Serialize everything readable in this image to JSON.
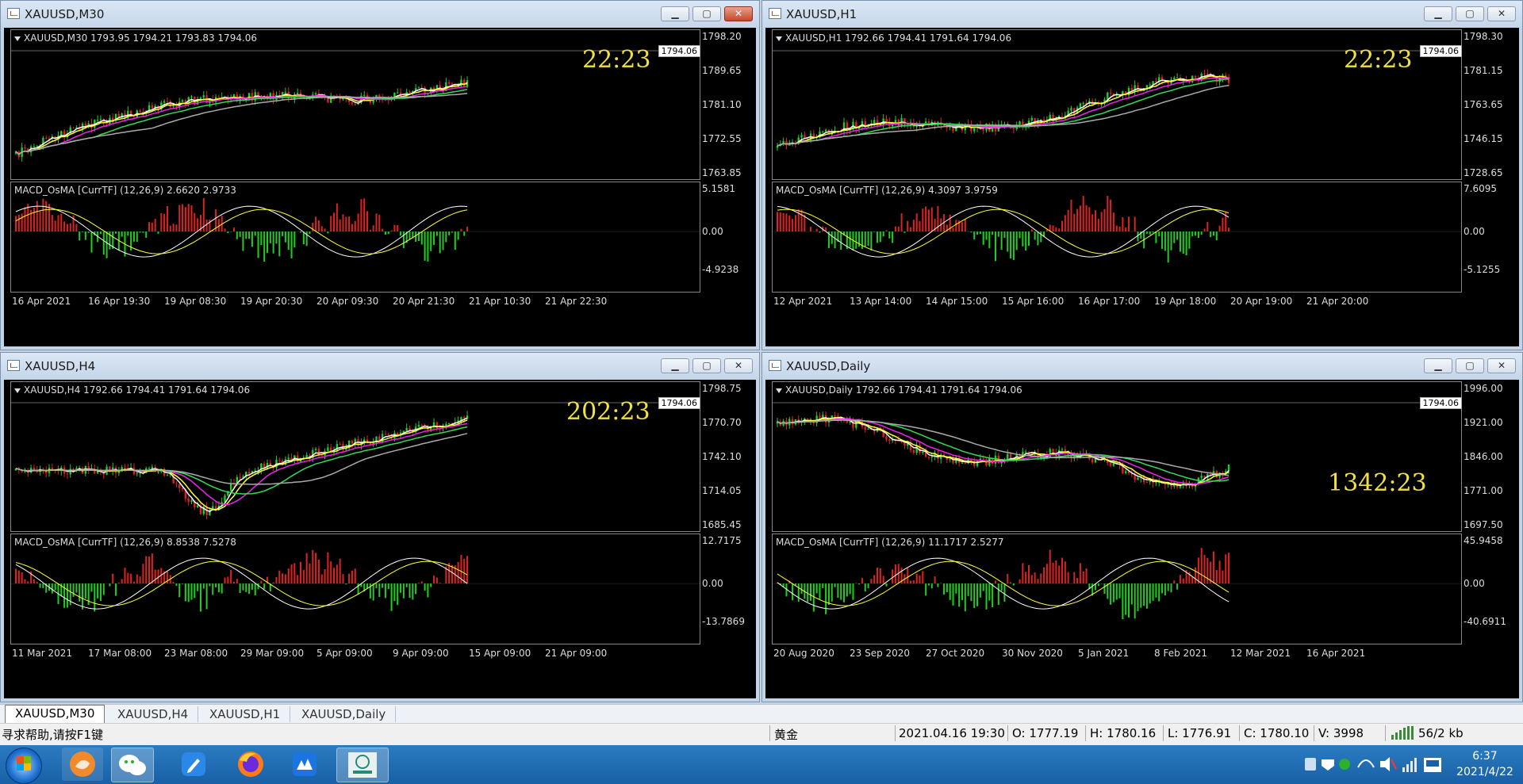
{
  "windows": [
    {
      "id": "m30",
      "title": "XAUUSD,M30",
      "active": true,
      "header": "XAUUSD,M30  1793.95 1794.21 1793.83 1794.06",
      "price_axis": [
        "1798.20",
        "1789.65",
        "1781.10",
        "1772.55",
        "1763.85"
      ],
      "price_tag": "1794.06",
      "countdown": "22:23",
      "macd_header": "MACD_OsMA [CurrTF] (12,26,9) 2.6620 2.9733",
      "macd_axis": [
        "5.1581",
        "0.00",
        "-4.9238"
      ],
      "times": [
        "16 Apr 2021",
        "16 Apr 19:30",
        "19 Apr 08:30",
        "19 Apr 20:30",
        "20 Apr 09:30",
        "20 Apr 21:30",
        "21 Apr 10:30",
        "21 Apr 22:30"
      ]
    },
    {
      "id": "h1",
      "title": "XAUUSD,H1",
      "active": false,
      "header": "XAUUSD,H1  1792.66 1794.41 1791.64 1794.06",
      "price_axis": [
        "1798.30",
        "1781.15",
        "1763.65",
        "1746.15",
        "1728.65"
      ],
      "price_tag": "1794.06",
      "countdown": "22:23",
      "macd_header": "MACD_OsMA [CurrTF] (12,26,9) 4.3097 3.9759",
      "macd_axis": [
        "7.6095",
        "0.00",
        "-5.1255"
      ],
      "times": [
        "12 Apr 2021",
        "13 Apr 14:00",
        "14 Apr 15:00",
        "15 Apr 16:00",
        "16 Apr 17:00",
        "19 Apr 18:00",
        "20 Apr 19:00",
        "21 Apr 20:00"
      ]
    },
    {
      "id": "h4",
      "title": "XAUUSD,H4",
      "active": false,
      "header": "XAUUSD,H4  1792.66 1794.41 1791.64 1794.06",
      "price_axis": [
        "1798.75",
        "1770.70",
        "1742.10",
        "1714.05",
        "1685.45"
      ],
      "price_tag": "1794.06",
      "countdown": "202:23",
      "macd_header": "MACD_OsMA [CurrTF] (12,26,9) 8.8538 7.5278",
      "macd_axis": [
        "12.7175",
        "0.00",
        "-13.7869"
      ],
      "times": [
        "11 Mar 2021",
        "17 Mar 08:00",
        "23 Mar 08:00",
        "29 Mar 09:00",
        "5 Apr 09:00",
        "9 Apr 09:00",
        "15 Apr 09:00",
        "21 Apr 09:00"
      ]
    },
    {
      "id": "d1",
      "title": "XAUUSD,Daily",
      "active": false,
      "header": "XAUUSD,Daily  1792.66 1794.41 1791.64 1794.06",
      "price_axis": [
        "1996.00",
        "1921.00",
        "1846.00",
        "1771.00",
        "1697.50"
      ],
      "price_tag": "1794.06",
      "countdown": "1342:23",
      "macd_header": "MACD_OsMA [CurrTF] (12,26,9) 11.1717 2.5277",
      "macd_axis": [
        "45.9458",
        "0.00",
        "-40.6911"
      ],
      "times": [
        "20 Aug 2020",
        "23 Sep 2020",
        "27 Oct 2020",
        "30 Nov 2020",
        "5 Jan 2021",
        "8 Feb 2021",
        "12 Mar 2021",
        "16 Apr 2021"
      ]
    }
  ],
  "tabs": [
    "XAUUSD,M30",
    "XAUUSD,H4",
    "XAUUSD,H1",
    "XAUUSD,Daily"
  ],
  "status": {
    "help": "寻求帮助,请按F1键",
    "symbol": "黄金",
    "datetime": "2021.04.16 19:30",
    "open": "O: 1777.19",
    "high": "H: 1780.16",
    "low": "L: 1776.91",
    "close": "C: 1780.10",
    "volume": "V: 3998",
    "traffic": "56/2 kb"
  },
  "clock": {
    "time": "6:37",
    "date": "2021/4/22"
  },
  "colors": {
    "bull": "#22cc22",
    "bear": "#dd2222",
    "ma_white": "#ffffff",
    "ma_yellow": "#ffff33",
    "ma_magenta": "#ee22ee",
    "ma_green": "#33dd55",
    "ma_gray": "#aaaaaa",
    "countdown": "#f0e040"
  }
}
